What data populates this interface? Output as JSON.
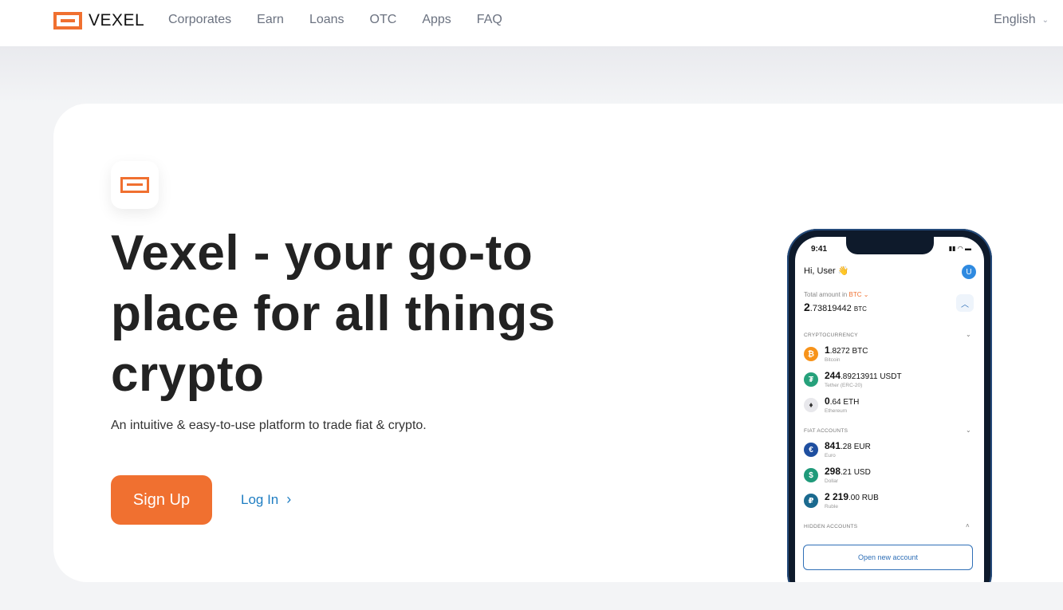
{
  "brand": {
    "name": "VEXEL"
  },
  "nav": {
    "items": [
      "Corporates",
      "Earn",
      "Loans",
      "OTC",
      "Apps",
      "FAQ"
    ]
  },
  "language": {
    "selected": "English"
  },
  "hero": {
    "title": "Vexel - your go-to place for all things crypto",
    "subtitle": "An intuitive & easy-to-use platform to trade fiat & crypto.",
    "signup_label": "Sign Up",
    "login_label": "Log In"
  },
  "phone": {
    "time": "9:41",
    "greeting": "Hi, User 👋",
    "avatar_letter": "U",
    "total_label": "Total amount in",
    "total_currency": "BTC",
    "total_int": "2",
    "total_dec": ".73819442",
    "total_unit": "BTC",
    "crypto_section": "CRYPTOCURRENCY",
    "crypto": [
      {
        "int": "1",
        "dec": ".8272 BTC",
        "name": "Bitcoin",
        "symbol": "₿",
        "color": "#f7931a"
      },
      {
        "int": "244",
        "dec": ".89213911 USDT",
        "name": "Tether (ERC-20)",
        "symbol": "₮",
        "color": "#26a17b"
      },
      {
        "int": "0",
        "dec": ".64 ETH",
        "name": "Ethereum",
        "symbol": "♦",
        "color": "#e8e8ec"
      }
    ],
    "fiat_section": "FIAT ACCOUNTS",
    "fiat": [
      {
        "int": "841",
        "dec": ".28 EUR",
        "name": "Euro",
        "symbol": "€",
        "color": "#1f4fa0"
      },
      {
        "int": "298",
        "dec": ".21 USD",
        "name": "Dollar",
        "symbol": "$",
        "color": "#1f9a7a"
      },
      {
        "int": "2 219",
        "dec": ".00 RUB",
        "name": "Ruble",
        "symbol": "₽",
        "color": "#1b6a8f"
      }
    ],
    "hidden_section": "HIDDEN ACCOUNTS",
    "open_account_label": "Open new account"
  },
  "colors": {
    "accent": "#f07030",
    "link": "#1e7dc2"
  }
}
